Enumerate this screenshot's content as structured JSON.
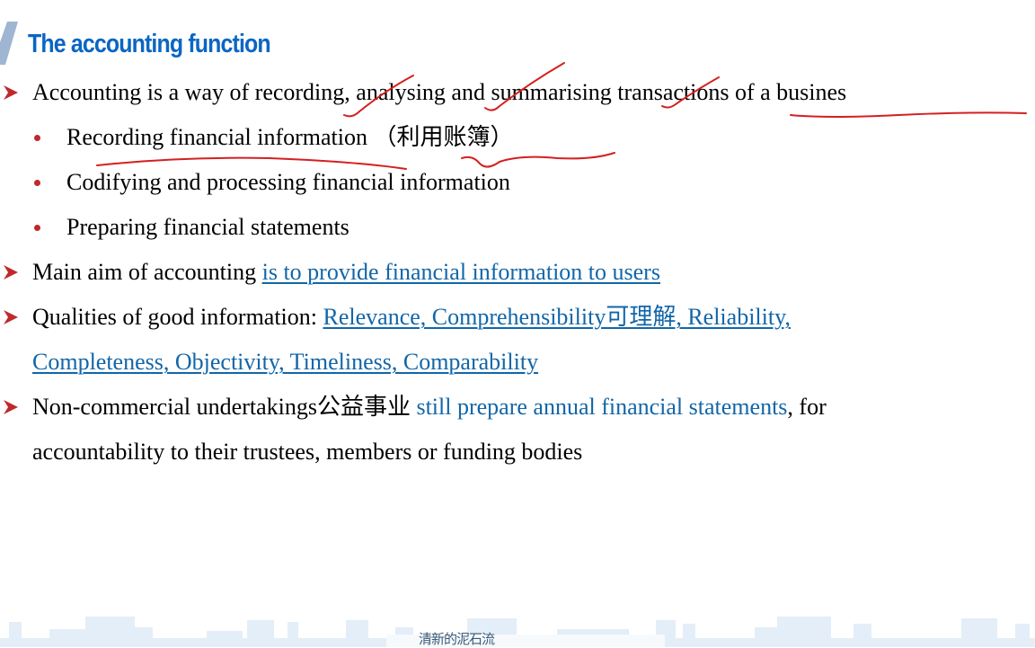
{
  "slide": {
    "title": "The accounting function",
    "bullets": [
      {
        "level": 1,
        "marker": "arrow-icon",
        "segments": [
          {
            "text": "Accounting is a way of recording, analysing and summarising transactions of a busines",
            "style": "plain"
          }
        ]
      },
      {
        "level": 2,
        "marker": "dot",
        "segments": [
          {
            "text": "Recording financial information （利用账簿）",
            "style": "plain"
          }
        ]
      },
      {
        "level": 2,
        "marker": "dot",
        "segments": [
          {
            "text": "Codifying and processing financial information",
            "style": "plain"
          }
        ]
      },
      {
        "level": 2,
        "marker": "dot",
        "segments": [
          {
            "text": "Preparing financial statements",
            "style": "plain"
          }
        ]
      },
      {
        "level": 1,
        "marker": "arrow-icon",
        "segments": [
          {
            "text": "Main aim of accounting ",
            "style": "plain"
          },
          {
            "text": "is to provide financial information to users",
            "style": "link"
          }
        ]
      },
      {
        "level": 1,
        "marker": "arrow-icon",
        "segments": [
          {
            "text": "Qualities of good information: ",
            "style": "plain"
          },
          {
            "text": "Relevance, Comprehensibility可理解, Reliability,",
            "style": "link"
          }
        ],
        "continuation": [
          {
            "text": "Completeness, Objectivity, Timeliness, Comparability",
            "style": "link"
          }
        ]
      },
      {
        "level": 1,
        "marker": "arrow-icon",
        "segments": [
          {
            "text": "Non-commercial undertakings公益事业 ",
            "style": "plain"
          },
          {
            "text": "still prepare annual financial statements",
            "style": "blue"
          },
          {
            "text": ", for",
            "style": "plain"
          }
        ],
        "continuation": [
          {
            "text": "accountability to their trustees, members or funding bodies",
            "style": "plain"
          }
        ]
      }
    ],
    "footer_watermark": "清新的泥石流"
  },
  "colors": {
    "title": "#0b66c3",
    "link": "#1266a8",
    "bullet_red": "#c0282b",
    "annotation_red": "#d42020",
    "skyline": "#dcebf7"
  }
}
